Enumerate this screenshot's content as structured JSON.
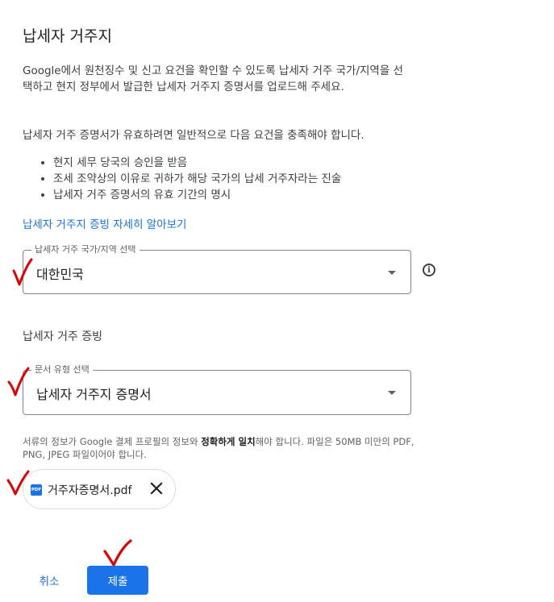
{
  "dialog": {
    "title": "납세자 거주지",
    "intro": "Google에서 원천징수 및 신고 요건을 확인할 수 있도록 납세자 거주 국가/지역을 선택하고 현지 정부에서 발급한 납세자 거주지 증명서를 업로드해 주세요.",
    "requirements_intro": "납세자 거주 증명서가 유효하려면 일반적으로 다음 요건을 충족해야 합니다.",
    "requirements": [
      "현지 세무 당국의 승인을 받음",
      "조세 조약상의 이유로 귀하가 해당 국가의 납세 거주자라는 진술",
      "납세자 거주 증명서의 유효 기간의 명시"
    ],
    "learn_more_link": "납세자 거주지 증빙 자세히 알아보기"
  },
  "country_select": {
    "label": "납세자 거주 국가/지역 선택",
    "value": "대한민국",
    "icon": "info-icon"
  },
  "proof_section": {
    "title": "납세자 거주 증빙",
    "document_type_select": {
      "label": "문서 유형 선택",
      "value": "납세자 거주지 증명서"
    },
    "note_prefix": "서류의 정보가 Google 결제 프로필의 정보와 ",
    "note_bold": "정확하게 일치",
    "note_suffix": "해야 합니다. 파일은 50MB 미만의 PDF, PNG, JPEG 파일이어야 합니다.",
    "file": {
      "icon_text": "PDF",
      "name": "거주자증명서.pdf"
    }
  },
  "actions": {
    "cancel_label": "취소",
    "submit_label": "제출"
  },
  "colors": {
    "accent": "#1a73e8",
    "annotation_red": "#e00000"
  }
}
